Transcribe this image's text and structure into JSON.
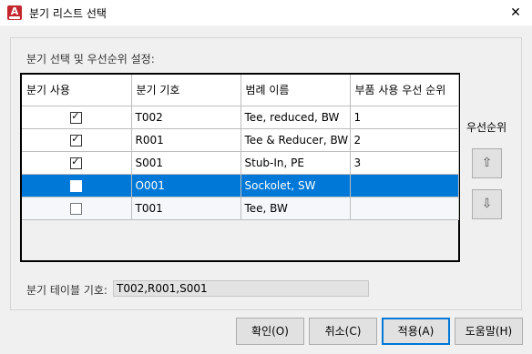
{
  "window": {
    "title": "분기 리스트 선택",
    "close_glyph": "✕",
    "icon_letter": "A"
  },
  "section_label": "분기 선택 및 우선순위 설정:",
  "table": {
    "headers": [
      "분기 사용",
      "분기 기호",
      "범례 이름",
      "부품 사용 우선 순위"
    ],
    "rows": [
      {
        "use": true,
        "code": "T002",
        "legend": "Tee, reduced, BW",
        "priority": "1",
        "selected": false
      },
      {
        "use": true,
        "code": "R001",
        "legend": "Tee & Reducer, BW",
        "priority": "2",
        "selected": false
      },
      {
        "use": true,
        "code": "S001",
        "legend": "Stub-In, PE",
        "priority": "3",
        "selected": false
      },
      {
        "use": false,
        "code": "O001",
        "legend": "Sockolet, SW",
        "priority": "",
        "selected": true
      },
      {
        "use": false,
        "code": "T001",
        "legend": "Tee, BW",
        "priority": "",
        "selected": false
      }
    ]
  },
  "priority": {
    "label": "우선순위",
    "up_icon": "⇧",
    "down_icon": "⇩"
  },
  "branch_code": {
    "label": "분기 테이블 기호:",
    "value": "T002,R001,S001"
  },
  "buttons": {
    "ok": "확인(O)",
    "cancel": "취소(C)",
    "apply": "적용(A)",
    "help": "도움말(H)"
  }
}
